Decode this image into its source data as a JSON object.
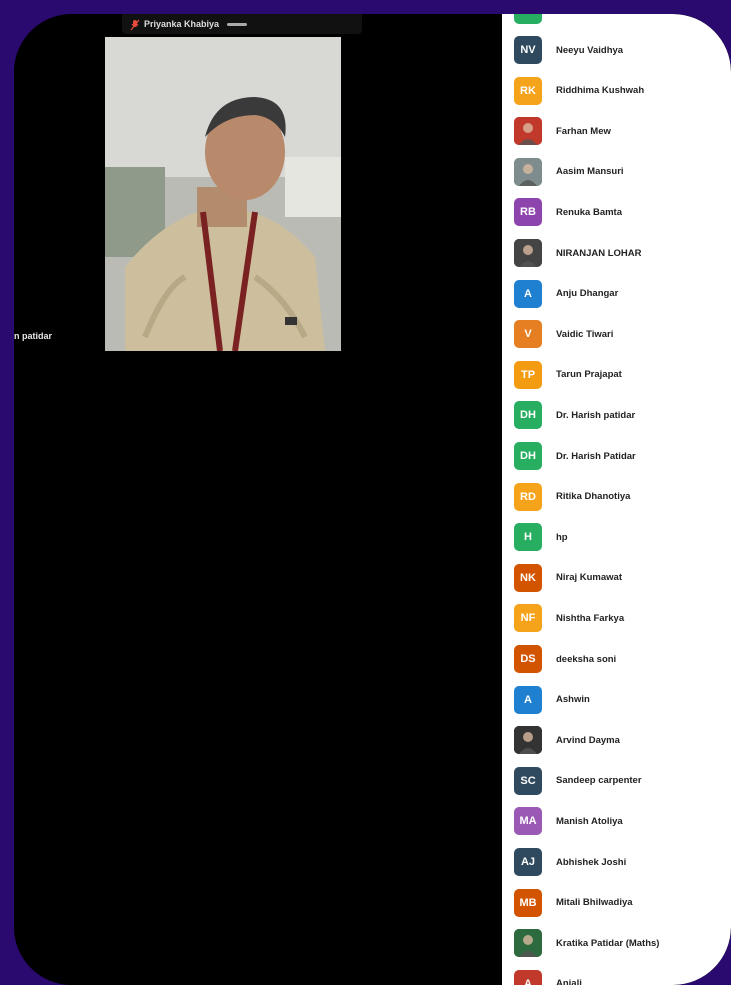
{
  "meeting": {
    "active_speaker_name": "Priyanka Khabiya",
    "side_label": "n patidar"
  },
  "participants": [
    {
      "initials": "NV",
      "name": "Neeyu Vaidhya",
      "color": "#2f4a5e",
      "photo": false
    },
    {
      "initials": "RK",
      "name": "Riddhima Kushwah",
      "color": "#f5a31a",
      "photo": false
    },
    {
      "initials": "",
      "name": "Farhan Mew",
      "color": "#c0392b",
      "photo": true
    },
    {
      "initials": "",
      "name": "Aasim Mansuri",
      "color": "#7f8c8d",
      "photo": true
    },
    {
      "initials": "RB",
      "name": "Renuka Bamta",
      "color": "#8e44ad",
      "photo": false
    },
    {
      "initials": "",
      "name": "NIRANJAN LOHAR",
      "color": "#444",
      "photo": true
    },
    {
      "initials": "A",
      "name": "Anju Dhangar",
      "color": "#1f7fd1",
      "photo": false
    },
    {
      "initials": "V",
      "name": "Vaidic Tiwari",
      "color": "#e67e22",
      "photo": false
    },
    {
      "initials": "TP",
      "name": "Tarun Prajapat",
      "color": "#f39c12",
      "photo": false
    },
    {
      "initials": "DH",
      "name": "Dr. Harish patidar",
      "color": "#27ae60",
      "photo": false
    },
    {
      "initials": "DH",
      "name": "Dr. Harish Patidar",
      "color": "#27ae60",
      "photo": false
    },
    {
      "initials": "RD",
      "name": "Ritika Dhanotiya",
      "color": "#f5a31a",
      "photo": false
    },
    {
      "initials": "H",
      "name": "hp",
      "color": "#27ae60",
      "photo": false
    },
    {
      "initials": "NK",
      "name": "Niraj Kumawat",
      "color": "#d35400",
      "photo": false
    },
    {
      "initials": "NF",
      "name": "Nishtha Farkya",
      "color": "#f5a31a",
      "photo": false
    },
    {
      "initials": "DS",
      "name": "deeksha soni",
      "color": "#d35400",
      "photo": false
    },
    {
      "initials": "A",
      "name": "Ashwin",
      "color": "#1f7fd1",
      "photo": false
    },
    {
      "initials": "",
      "name": "Arvind Dayma",
      "color": "#333",
      "photo": true
    },
    {
      "initials": "SC",
      "name": "Sandeep carpenter",
      "color": "#2f4a5e",
      "photo": false
    },
    {
      "initials": "MA",
      "name": "Manish Atoliya",
      "color": "#9b59b6",
      "photo": false
    },
    {
      "initials": "AJ",
      "name": "Abhishek Joshi",
      "color": "#2f4a5e",
      "photo": false
    },
    {
      "initials": "MB",
      "name": "Mitali Bhilwadiya",
      "color": "#d35400",
      "photo": false
    },
    {
      "initials": "",
      "name": "Kratika Patidar (Maths)",
      "color": "#2d6a3e",
      "photo": true
    },
    {
      "initials": "A",
      "name": "Anjali",
      "color": "#c0392b",
      "photo": false
    }
  ]
}
